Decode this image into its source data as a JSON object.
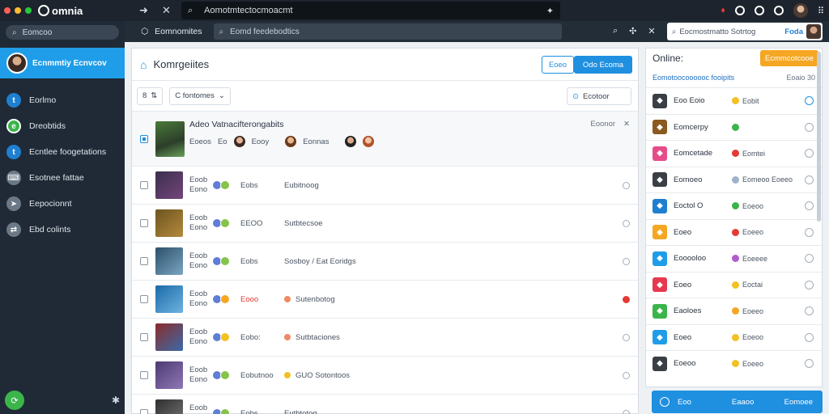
{
  "titlebar": {
    "app_name": "omnia",
    "url": "Aomotmtectocmoacmt",
    "traffic_colors": [
      "#ff5f57",
      "#febc2e",
      "#28c840"
    ]
  },
  "sidebar": {
    "search_placeholder": "Eomcoo",
    "profile_name": "Ecnmmtiy Ecnvcov",
    "items": [
      {
        "label": "Eorlmo",
        "icon": "t",
        "color": "#1f7fd0"
      },
      {
        "label": "Dreobtids",
        "icon": "e",
        "color": "#3bb54a"
      },
      {
        "label": "Ecntlee foogetations",
        "icon": "t",
        "color": "#1f7fd0"
      },
      {
        "label": "Esotnee fattae",
        "icon": "keyboard-icon",
        "color": "#6b7886"
      },
      {
        "label": "Eepocionnt",
        "icon": "send-icon",
        "color": "#6b7886"
      },
      {
        "label": "Ebd colints",
        "icon": "share-icon",
        "color": "#6b7886"
      }
    ]
  },
  "toolbar": {
    "workspace": "Eomnomites",
    "search_placeholder": "Eomd feedebodtics",
    "invite_placeholder": "Eocmostmatto Sotrtog",
    "invite_button": "Foda"
  },
  "main": {
    "title": "Komrgeiites",
    "button_secondary": "Eoeo",
    "button_primary": "Odo Ecoma",
    "filter_count": "8",
    "filter_dropdown": "C fontomes",
    "filter_right": "Ecotoor",
    "featured": {
      "title": "Adeo Vatnacifterongabits",
      "meta1": "Eoeos",
      "meta1b": "Eo",
      "meta2": "Eooy",
      "meta3": "Eonnas",
      "status": "Eoonor"
    },
    "rows": [
      {
        "t1": "Eoob",
        "t2": "Eono",
        "name": "Eobs",
        "detail": "Eubitnoog",
        "dot": "",
        "thumb": [
          "#3b2f4d",
          "#74457a"
        ],
        "b": [
          "#5f7fd6",
          "#86c34a"
        ],
        "active": false
      },
      {
        "t1": "Eoob",
        "t2": "Eono",
        "name": "EEOO",
        "detail": "Sutbtecsoe",
        "dot": "",
        "thumb": [
          "#6d5420",
          "#b48a3c"
        ],
        "b": [
          "#5f7fd6",
          "#86c34a"
        ],
        "active": false
      },
      {
        "t1": "Eoob",
        "t2": "Eono",
        "name": "Eobs",
        "detail": "Sosboy / Eat Eoridgs",
        "dot": "",
        "thumb": [
          "#2c4f6a",
          "#7aa6c2"
        ],
        "b": [
          "#5f7fd6",
          "#86c34a"
        ],
        "active": false
      },
      {
        "t1": "Eoob",
        "t2": "Eono",
        "name": "Eooo",
        "detail": "Sutenbotog",
        "dot": "#ef8a65",
        "thumb": [
          "#1b6aa8",
          "#6eb3e0"
        ],
        "b": [
          "#5f7fd6",
          "#f5a623"
        ],
        "active": true
      },
      {
        "t1": "Eoob",
        "t2": "Eono",
        "name": "Eobo:",
        "detail": "Sutbtaciones",
        "dot": "#ef8a65",
        "thumb": [
          "#8a2c2c",
          "#3b6aa8"
        ],
        "b": [
          "#5f7fd6",
          "#f5c023"
        ],
        "active": false
      },
      {
        "t1": "Eoob",
        "t2": "Eono",
        "name": "Eobutnoo",
        "detail": "GUO Sotontoos",
        "dot": "#f5c023",
        "thumb": [
          "#4d3a73",
          "#8e78b5"
        ],
        "b": [
          "#5f7fd6",
          "#86c34a"
        ],
        "active": false
      },
      {
        "t1": "Eoob",
        "t2": "Eono",
        "name": "Eobs",
        "detail": "Eutbtotog",
        "dot": "",
        "thumb": [
          "#2f2f2f",
          "#777777"
        ],
        "b": [
          "#5f7fd6",
          "#86c34a"
        ],
        "active": false
      }
    ]
  },
  "right": {
    "title": "Online:",
    "button": "Ecmmcotcooe",
    "subtitle": "Eomotoocoooooc fooipits",
    "count": "Eoaio 30",
    "rows": [
      {
        "name": "Eoo Eoio",
        "status": "Eobit",
        "ic": "#3a3f45",
        "dot": "#f5c023",
        "go": "blue"
      },
      {
        "name": "Eomcerpy",
        "status": "",
        "ic": "#8a5a20",
        "dot": "#3bb54a",
        "go": ""
      },
      {
        "name": "Eomcetade",
        "status": "Eomtei",
        "ic": "#e44d8a",
        "dot": "#e53935",
        "go": ""
      },
      {
        "name": "Eomoeo",
        "status": "Eomeoo Eoeeo",
        "ic": "#3a3f45",
        "dot": "#9fb3c8",
        "go": ""
      },
      {
        "name": "Eoctol O",
        "status": "Eoeoo",
        "ic": "#1f7fd0",
        "dot": "#3bb54a",
        "go": ""
      },
      {
        "name": "Eoeo",
        "status": "Eoeeo",
        "ic": "#f5a623",
        "dot": "#e53935",
        "go": ""
      },
      {
        "name": "Eooooloo",
        "status": "Eoeeee",
        "ic": "#1f9de8",
        "dot": "#b05bd0",
        "go": ""
      },
      {
        "name": "Eoeo",
        "status": "Eoctai",
        "ic": "#e53950",
        "dot": "#f5c023",
        "go": ""
      },
      {
        "name": "Eaoloes",
        "status": "Eoeeo",
        "ic": "#3bb54a",
        "dot": "#f5a623",
        "go": ""
      },
      {
        "name": "Eoeo",
        "status": "Eoeoo",
        "ic": "#1f9de8",
        "dot": "#f5c023",
        "go": ""
      },
      {
        "name": "Eoeoo",
        "status": "Eoeeo",
        "ic": "#3a3f45",
        "dot": "#f5c023",
        "go": ""
      }
    ],
    "footer": [
      "Eoo",
      "Eaaoo",
      "Eomoee"
    ]
  }
}
